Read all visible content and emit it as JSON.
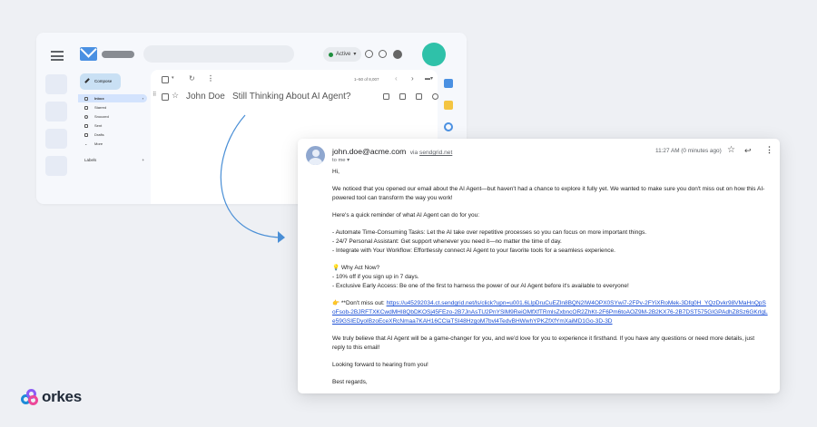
{
  "gmail": {
    "status": "Active",
    "compose_label": "Compose",
    "nav": [
      {
        "label": "Inbox",
        "icon": "inbox-icon"
      },
      {
        "label": "Starred",
        "icon": "star-icon"
      },
      {
        "label": "Snoozed",
        "icon": "clock-icon"
      },
      {
        "label": "Sent",
        "icon": "send-icon"
      },
      {
        "label": "Drafts",
        "icon": "draft-icon"
      },
      {
        "label": "More",
        "icon": "chevron-down-icon"
      }
    ],
    "labels_heading": "Labels",
    "labels_add": "+",
    "pager": "1–50 of 8,007",
    "row": {
      "from": "John Doe",
      "subject": "Still Thinking About AI Agent?"
    }
  },
  "email": {
    "from_address": "john.doe@acme.com",
    "via_word": "via",
    "via_domain": "sendgrid.net",
    "to_me": "to me",
    "time": "11:27 AM (0 minutes ago)",
    "greeting": "Hi,",
    "intro": "We noticed that you opened our email about the AI Agent—but haven't had a chance to explore it fully yet. We wanted to make sure you don't miss out on how this AI-powered tool can transform the way you work!",
    "reminder_heading": "Here's a quick reminder of what AI Agent can do for you:",
    "bullets": [
      "- Automate Time-Consuming Tasks: Let the AI take over repetitive processes so you can focus on more important things.",
      "- 24/7 Personal Assistant: Get support whenever you need it—no matter the time of day.",
      "- Integrate with Your Workflow: Effortlessly connect AI Agent to your favorite tools for a seamless experience."
    ],
    "why_heading": "💡 Why Act Now?",
    "why_items": [
      "- 10% off if you sign up in 7 days.",
      "- Exclusive Early Access: Be one of the first to harness the power of our AI Agent before it's available to everyone!"
    ],
    "dont_miss_prefix": "👉 **Don't miss out: ",
    "dont_miss_link": "https://u45292034.ct.sendgrid.net/ls/click?upn=u001.6LlpDruCuEZln8BQN2IW4OPX0SYwi7-2FPv-2FYiXRoMek-3Dfq0H_YQzDvkr98VMaHnQpSoFsob-2BJRFTXKCwdMHI8QbDKOSj45FEzo-2B7JnAsTU2PnYSlM9ReiOMfXfTRmlsZxbncOR2ZhKt-2F6Pm6toAOZ9M-2B2KX76-2B7DST575GIGPAdhZ8Sz6GKrlgLe59GSIEDyoIBzoEceXRcNmaa7KAH16CClaTSI48HzgoM7bvl4TedvBHWwhYPKZfXfYmXaiMD1Go-3D-3D",
    "belief": "We truly believe that AI Agent will be a game-changer for you, and we'd love for you to experience it firsthand. If you have any questions or need more details, just reply to this email!",
    "looking_forward": "Looking forward to hearing from you!",
    "sign_off": "Best regards,"
  },
  "brand": {
    "name": "orkes"
  },
  "colors": {
    "accent": "#2fc1a9",
    "arrow": "#4a8fd6",
    "link": "#1a4fd6"
  }
}
